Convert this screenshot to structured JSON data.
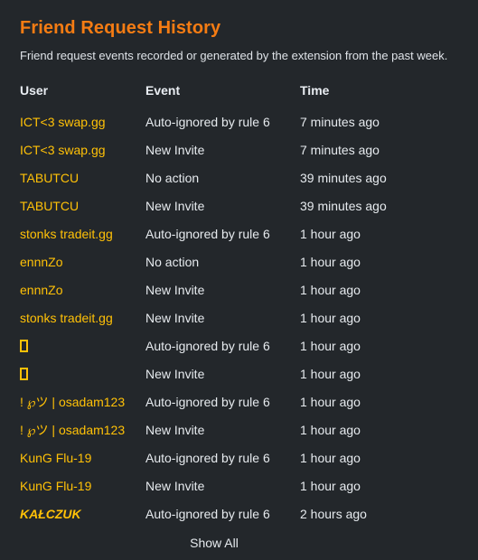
{
  "header": {
    "title": "Friend Request History",
    "subtitle": "Friend request events recorded or generated by the extension from the past week."
  },
  "table": {
    "columns": [
      "User",
      "Event",
      "Time"
    ],
    "rows": [
      {
        "user": "ICT<3 swap.gg",
        "event": "Auto-ignored by rule 6",
        "time": "7 minutes ago",
        "style": "normal"
      },
      {
        "user": "ICT<3 swap.gg",
        "event": "New Invite",
        "time": "7 minutes ago",
        "style": "normal"
      },
      {
        "user": "TABUTCU",
        "event": "No action",
        "time": "39 minutes ago",
        "style": "normal"
      },
      {
        "user": "TABUTCU",
        "event": "New Invite",
        "time": "39 minutes ago",
        "style": "normal"
      },
      {
        "user": "stonks tradeit.gg",
        "event": "Auto-ignored by rule 6",
        "time": "1 hour ago",
        "style": "normal"
      },
      {
        "user": "ennnZo",
        "event": "No action",
        "time": "1 hour ago",
        "style": "normal"
      },
      {
        "user": "ennnZo",
        "event": "New Invite",
        "time": "1 hour ago",
        "style": "normal"
      },
      {
        "user": "stonks tradeit.gg",
        "event": "New Invite",
        "time": "1 hour ago",
        "style": "normal"
      },
      {
        "user": "",
        "event": "Auto-ignored by rule 6",
        "time": "1 hour ago",
        "style": "tofu"
      },
      {
        "user": "",
        "event": "New Invite",
        "time": "1 hour ago",
        "style": "tofu"
      },
      {
        "user": "! ℘ツ | osadam123",
        "event": "Auto-ignored by rule 6",
        "time": "1 hour ago",
        "style": "normal"
      },
      {
        "user": "! ℘ツ | osadam123",
        "event": "New Invite",
        "time": "1 hour ago",
        "style": "normal"
      },
      {
        "user": "KunG Flu-19",
        "event": "Auto-ignored by rule 6",
        "time": "1 hour ago",
        "style": "normal"
      },
      {
        "user": "KunG Flu-19",
        "event": "New Invite",
        "time": "1 hour ago",
        "style": "normal"
      },
      {
        "user": "KAŁCZUK",
        "event": "Auto-ignored by rule 6",
        "time": "2 hours ago",
        "style": "italic"
      }
    ]
  },
  "footer": {
    "show_all_label": "Show All"
  },
  "colors": {
    "background": "#23272b",
    "title": "#f57c13",
    "username": "#ffc107",
    "text": "#e6eaee"
  }
}
